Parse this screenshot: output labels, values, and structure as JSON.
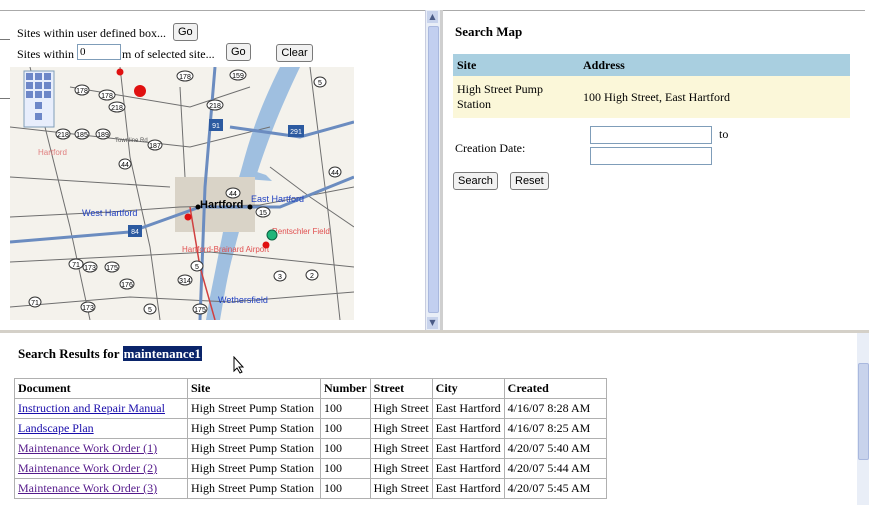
{
  "left_pane": {
    "box_label": "Sites within user defined box...",
    "go_label": "Go",
    "sites_within_label": "Sites within",
    "distance_value": "0",
    "of_selected_label": "m of selected site...",
    "go2_label": "Go",
    "clear_label": "Clear"
  },
  "map": {
    "places": [
      "Hartford",
      "East Hartford",
      "West Hartford",
      "Wethersfield",
      "Hartford-Brainard Airport",
      "Rentschler Field",
      "Townline Rd",
      "Bloomfield",
      "Burnside Av",
      "Farmington Av"
    ],
    "routes": [
      "91",
      "84",
      "291",
      "44",
      "2",
      "3",
      "5",
      "15",
      "178",
      "189",
      "218",
      "185",
      "173",
      "71",
      "175",
      "187",
      "314"
    ]
  },
  "search_map": {
    "title": "Search Map",
    "columns": [
      "Site",
      "Address"
    ],
    "site": "High Street Pump Station",
    "address": "100 High Street, East Hartford",
    "creation_date_label": "Creation Date:",
    "to_label": "to",
    "search_label": "Search",
    "reset_label": "Reset"
  },
  "results": {
    "title": "Search Results for",
    "term": "maintenance1",
    "columns": [
      "Document",
      "Site",
      "Number",
      "Street",
      "City",
      "Created"
    ],
    "rows": [
      {
        "document": "Instruction and Repair Manual",
        "site": "High Street Pump Station",
        "number": "100",
        "street": "High Street",
        "city": "East Hartford",
        "created": "4/16/07 8:28 AM"
      },
      {
        "document": "Landscape Plan",
        "site": "High Street Pump Station",
        "number": "100",
        "street": "High Street",
        "city": "East Hartford",
        "created": "4/16/07 8:25 AM"
      },
      {
        "document": "Maintenance Work Order (1)",
        "site": "High Street Pump Station",
        "number": "100",
        "street": "High Street",
        "city": "East Hartford",
        "created": "4/20/07 5:40 AM"
      },
      {
        "document": "Maintenance Work Order (2)",
        "site": "High Street Pump Station",
        "number": "100",
        "street": "High Street",
        "city": "East Hartford",
        "created": "4/20/07 5:44 AM"
      },
      {
        "document": "Maintenance Work Order (3)",
        "site": "High Street Pump Station",
        "number": "100",
        "street": "High Street",
        "city": "East Hartford",
        "created": "4/20/07 5:45 AM"
      }
    ]
  },
  "colors": {
    "table_header": "#a9cfe0",
    "table_row": "#fbf7d9",
    "highlight": "#0a246a",
    "link": "#1a0dab",
    "visited": "#551a8b"
  }
}
